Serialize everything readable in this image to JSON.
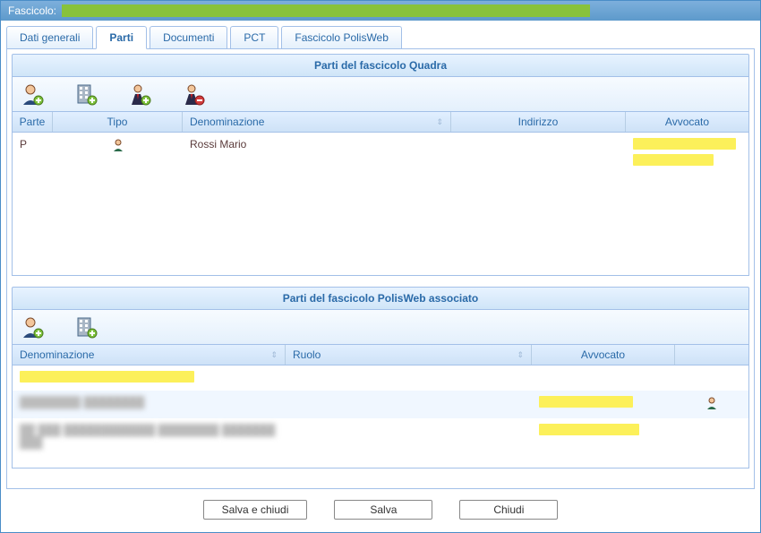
{
  "titleBar": {
    "label": "Fascicolo:"
  },
  "tabs": {
    "dati_generali": "Dati generali",
    "parti": "Parti",
    "documenti": "Documenti",
    "pct": "PCT",
    "fascicolo_polisweb": "Fascicolo PolisWeb"
  },
  "quadra": {
    "title": "Parti del fascicolo Quadra",
    "toolbar_icons": [
      "add-person-icon",
      "add-building-icon",
      "add-businessman-icon",
      "remove-businessman-icon"
    ],
    "columns": {
      "parte": "Parte",
      "tipo": "Tipo",
      "denominazione": "Denominazione",
      "indirizzo": "Indirizzo",
      "avvocato": "Avvocato"
    },
    "rows": [
      {
        "parte": "P",
        "tipo_icon": "person-icon",
        "denominazione": "Rossi Mario",
        "indirizzo": "",
        "avvocato_redacted": true
      }
    ]
  },
  "polisweb": {
    "title": "Parti del fascicolo PolisWeb associato",
    "toolbar_icons": [
      "add-person-icon",
      "add-building-icon"
    ],
    "columns": {
      "denominazione": "Denominazione",
      "ruolo": "Ruolo",
      "avvocato": "Avvocato"
    },
    "rows": [
      {
        "denominazione_redacted": true,
        "ruolo": "",
        "avvocato": ""
      },
      {
        "denominazione_blur": true,
        "ruolo": "",
        "avvocato_redacted": true,
        "has_person_icon": true
      },
      {
        "denominazione_blur": true,
        "ruolo": "",
        "avvocato_redacted": true
      }
    ]
  },
  "buttons": {
    "save_close": "Salva e chiudi",
    "save": "Salva",
    "close": "Chiudi"
  }
}
